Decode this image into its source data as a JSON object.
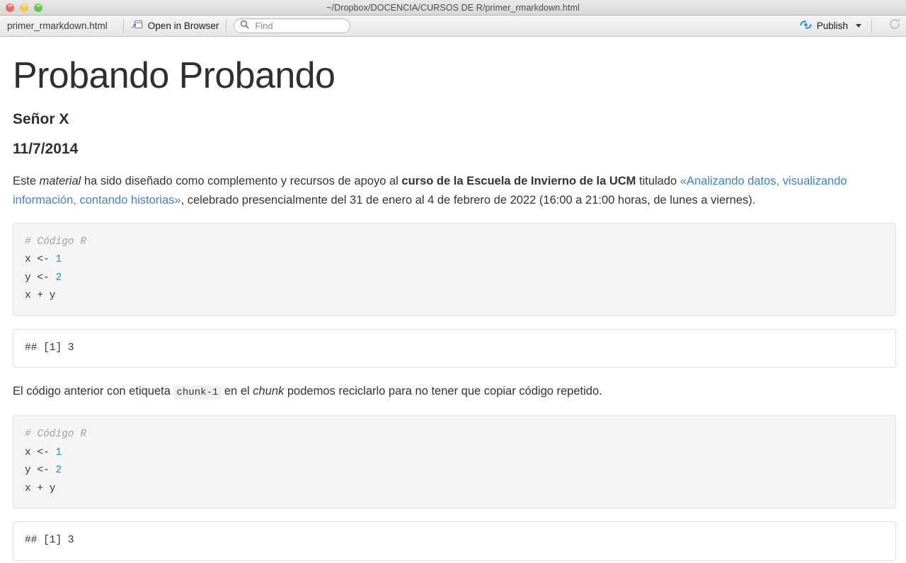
{
  "window": {
    "title": "~/Dropbox/DOCENCIA/CURSOS DE R/primer_rmarkdown.html",
    "traffic_lights": [
      {
        "name": "close",
        "color": "#ed6a5e"
      },
      {
        "name": "minimize",
        "color": "#f5c451"
      },
      {
        "name": "zoom",
        "color": "#62c554"
      }
    ]
  },
  "toolbar": {
    "doc_name": "primer_rmarkdown.html",
    "open_in_browser_label": "Open in Browser",
    "open_in_browser_icon": "open-in-browser-icon",
    "find_placeholder": "Find",
    "find_value": "",
    "find_icon": "search-icon",
    "publish_label": "Publish",
    "publish_icon": "publish-icon",
    "publish_icon_color": "#2196d9",
    "publish_caret_icon": "chevron-down-icon",
    "refresh_icon": "refresh-icon",
    "refresh_icon_color": "#c3c9cf"
  },
  "document": {
    "title": "Probando Probando",
    "author": "Señor X",
    "date": "11/7/2014",
    "intro": {
      "t1": "Este ",
      "em1": "material",
      "t2": " ha sido diseñado como complemento y recursos de apoyo al ",
      "strong1": "curso de la Escuela de Invierno de la UCM",
      "t3": " titulado ",
      "link1": "«Analizando datos, visualizando información, contando historias»",
      "t4": ", celebrado presencialmente del 31 de enero al 4 de febrero de 2022 (16:00 a 21:00 horas, de lunes a viernes)."
    },
    "chunk_1": {
      "comment": "# Código R",
      "line2_a": "x <- ",
      "line2_n": "1",
      "line3_a": "y <- ",
      "line3_n": "2",
      "line4": "x + y"
    },
    "output_1": "## [1] 3",
    "middle": {
      "t1": "El código anterior con etiqueta ",
      "code1": "chunk-1",
      "t2": " en el ",
      "em1": "chunk",
      "t3": " podemos reciclarlo para no tener que copiar código repetido."
    },
    "chunk_2": {
      "comment": "# Código R",
      "line2_a": "x <- ",
      "line2_n": "1",
      "line3_a": "y <- ",
      "line3_n": "2",
      "line4": "x + y"
    },
    "output_2": "## [1] 3"
  },
  "colors": {
    "link": "#4183c4",
    "code_number": "#12a498",
    "code_comment": "#a0a0a0",
    "chunk_bg": "#f5f5f5"
  }
}
